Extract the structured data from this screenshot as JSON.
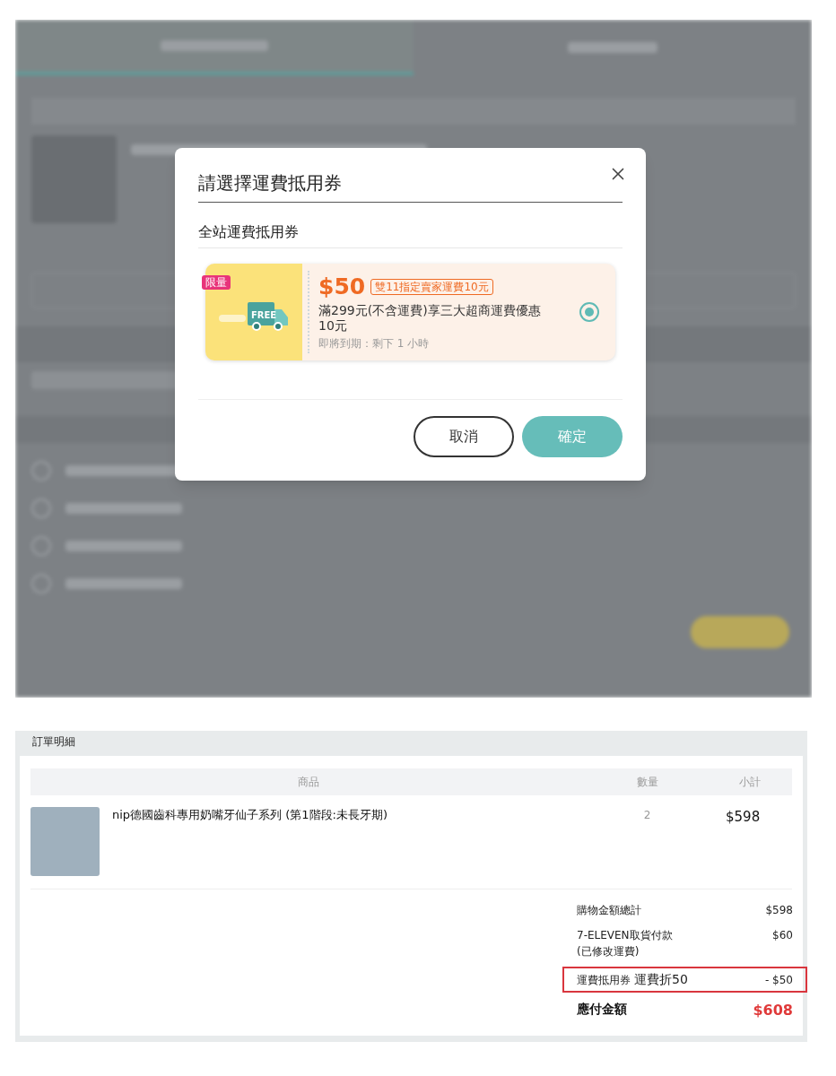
{
  "modal": {
    "title": "請選擇運費抵用券",
    "section_title": "全站運費抵用券",
    "coupons": [
      {
        "tag": "限量",
        "badge_text": "FREE",
        "amount": "$50",
        "label": "雙11指定賣家運費10元",
        "description": "滿299元(不含運費)享三大超商運費優惠10元",
        "expiry": "即將到期：剩下 1 小時",
        "selected": true
      }
    ],
    "buttons": [
      {
        "kind": "cancel",
        "label": "取消"
      },
      {
        "kind": "confirm",
        "label": "確定"
      }
    ]
  },
  "order_detail": {
    "title": "訂單明細",
    "columns": [
      "商品",
      "數量",
      "小計"
    ],
    "items": [
      {
        "name": "nip德國齒科專用奶嘴牙仙子系列 (第1階段:未長牙期)",
        "quantity": "2",
        "subtotal": "$598"
      }
    ],
    "summary": [
      {
        "kind": "line",
        "label": "購物金額總計",
        "value": "$598",
        "highlighted": false
      },
      {
        "kind": "line",
        "label": "7-ELEVEN取貨付款",
        "note": "(已修改運費)",
        "value": "$60",
        "highlighted": false
      },
      {
        "kind": "coupon",
        "label": "運費抵用券",
        "detail": "運費折50",
        "value": "- $50",
        "highlighted": true
      },
      {
        "kind": "total",
        "label": "應付金額",
        "value": "$608",
        "highlighted": false
      }
    ]
  }
}
